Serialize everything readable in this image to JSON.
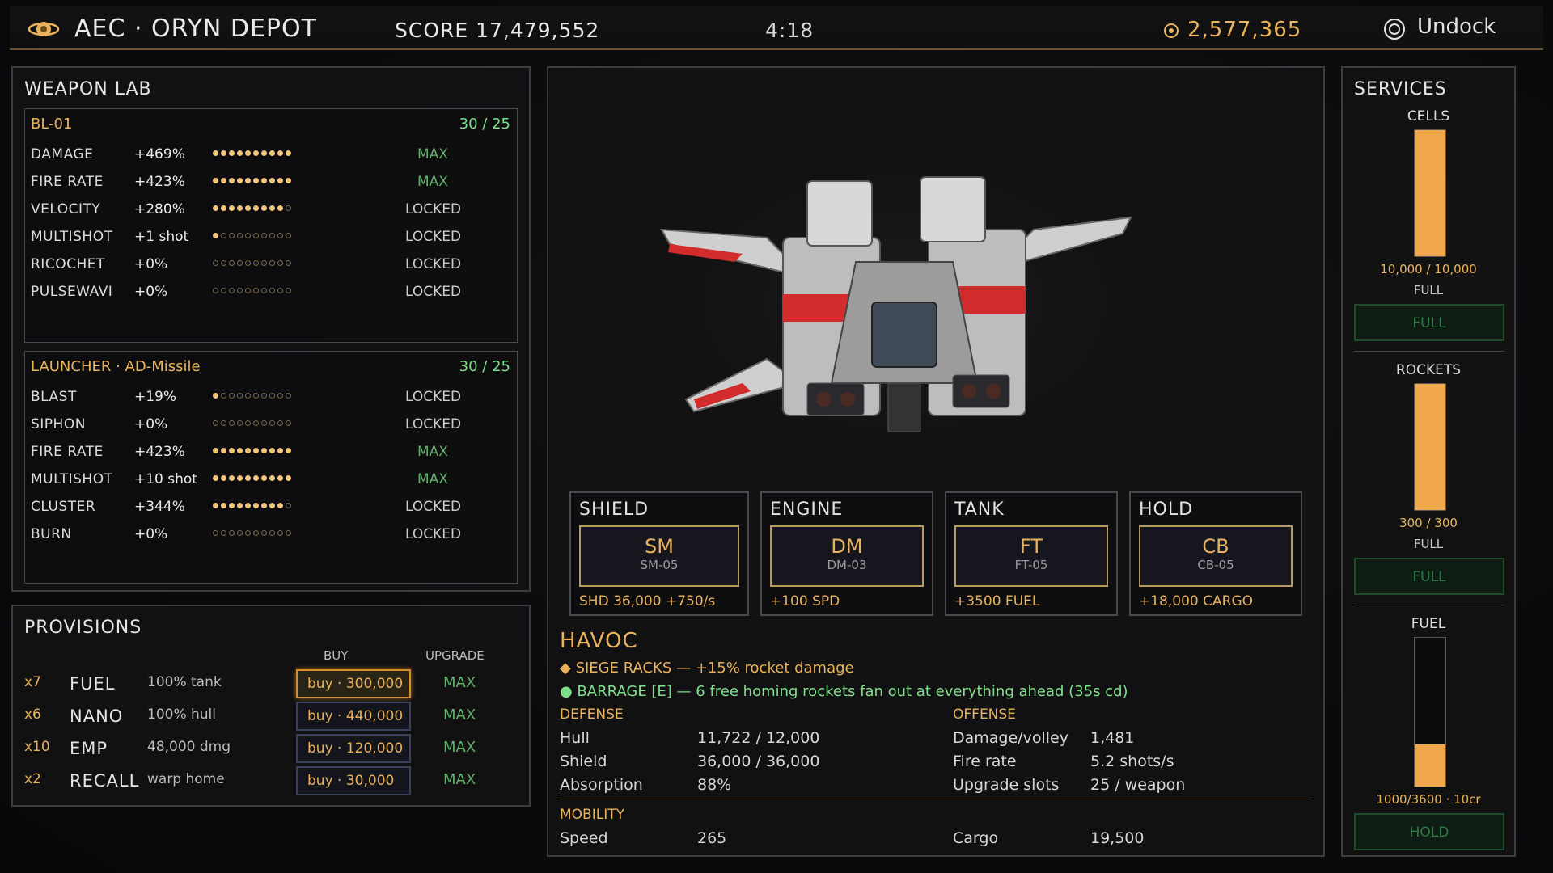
{
  "header": {
    "title": "AEC · ORYN DEPOT",
    "score": "SCORE 17,479,552",
    "timer": "4:18",
    "credits": "2,577,365",
    "undock_label": "Undock"
  },
  "weapon_lab": {
    "title": "WEAPON LAB",
    "weapons": [
      {
        "name": "BL-01",
        "level": "30 / 25",
        "stats": [
          {
            "name": "DAMAGE",
            "bonus": "+469%",
            "filled": 10,
            "status": "MAX"
          },
          {
            "name": "FIRE RATE",
            "bonus": "+423%",
            "filled": 10,
            "status": "MAX"
          },
          {
            "name": "VELOCITY",
            "bonus": "+280%",
            "filled": 9,
            "status": "LOCKED"
          },
          {
            "name": "MULTISHOT",
            "bonus": "+1 shot",
            "filled": 1,
            "status": "LOCKED"
          },
          {
            "name": "RICOCHET",
            "bonus": "+0%",
            "filled": 0,
            "status": "LOCKED"
          },
          {
            "name": "PULSEWAVI",
            "bonus": "+0%",
            "filled": 0,
            "status": "LOCKED"
          }
        ]
      },
      {
        "name": "LAUNCHER · AD-Missile",
        "level": "30 / 25",
        "stats": [
          {
            "name": "BLAST",
            "bonus": "+19%",
            "filled": 1,
            "status": "LOCKED"
          },
          {
            "name": "SIPHON",
            "bonus": "+0%",
            "filled": 0,
            "status": "LOCKED"
          },
          {
            "name": "FIRE RATE",
            "bonus": "+423%",
            "filled": 10,
            "status": "MAX"
          },
          {
            "name": "MULTISHOT",
            "bonus": "+10 shot",
            "filled": 10,
            "status": "MAX"
          },
          {
            "name": "CLUSTER",
            "bonus": "+344%",
            "filled": 9,
            "status": "LOCKED"
          },
          {
            "name": "BURN",
            "bonus": "+0%",
            "filled": 0,
            "status": "LOCKED"
          }
        ]
      }
    ]
  },
  "provisions": {
    "title": "PROVISIONS",
    "col_buy": "BUY",
    "col_upgrade": "UPGRADE",
    "items": [
      {
        "qty": "x7",
        "name": "FUEL",
        "desc": "100% tank",
        "buy": "buy · 300,000",
        "upgrade": "MAX"
      },
      {
        "qty": "x6",
        "name": "NANO",
        "desc": "100% hull",
        "buy": "buy · 440,000",
        "upgrade": "MAX"
      },
      {
        "qty": "x10",
        "name": "EMP",
        "desc": "48,000 dmg",
        "buy": "buy · 120,000",
        "upgrade": "MAX"
      },
      {
        "qty": "x2",
        "name": "RECALL",
        "desc": "warp home",
        "buy": "buy · 30,000",
        "upgrade": "MAX"
      }
    ]
  },
  "slots": [
    {
      "label": "SHIELD",
      "code": "SM",
      "model": "SM-05",
      "stat": "SHD 36,000 +750/s"
    },
    {
      "label": "ENGINE",
      "code": "DM",
      "model": "DM-03",
      "stat": "+100 SPD"
    },
    {
      "label": "TANK",
      "code": "FT",
      "model": "FT-05",
      "stat": "+3500 FUEL"
    },
    {
      "label": "HOLD",
      "code": "CB",
      "model": "CB-05",
      "stat": "+18,000 CARGO"
    }
  ],
  "ship": {
    "name": "HAVOC",
    "perk1": "◆ SIEGE RACKS — +15% rocket damage",
    "perk2": "● BARRAGE [E] — 6 free homing rockets fan out at everything ahead (35s cd)",
    "defense_title": "DEFENSE",
    "offense_title": "OFFENSE",
    "mobility_title": "MOBILITY",
    "defense": [
      {
        "label": "Hull",
        "value": "11,722 / 12,000"
      },
      {
        "label": "Shield",
        "value": "36,000 / 36,000"
      },
      {
        "label": "Absorption",
        "value": "88%"
      }
    ],
    "offense": [
      {
        "label": "Damage/volley",
        "value": "1,481"
      },
      {
        "label": "Fire rate",
        "value": "5.2 shots/s"
      },
      {
        "label": "Upgrade slots",
        "value": "25 / weapon"
      }
    ],
    "mobility": [
      {
        "label": "Speed",
        "value": "265"
      },
      {
        "label": "Cargo",
        "value": "19,500"
      }
    ]
  },
  "services": {
    "title": "SERVICES",
    "items": [
      {
        "name": "CELLS",
        "amount": "10,000 / 10,000",
        "fill_fraction": 1.0,
        "status": "FULL",
        "button": "FULL"
      },
      {
        "name": "ROCKETS",
        "amount": "300 / 300",
        "fill_fraction": 1.0,
        "status": "FULL",
        "button": "FULL"
      },
      {
        "name": "FUEL",
        "amount": "1000/3600 · 10cr",
        "fill_fraction": 0.28,
        "status": "",
        "button": "HOLD"
      }
    ]
  },
  "colors": {
    "accent": "#e9b25c",
    "max": "#5fb06a",
    "fill": "#f1a84d",
    "panel_border": "#3c3c40"
  }
}
